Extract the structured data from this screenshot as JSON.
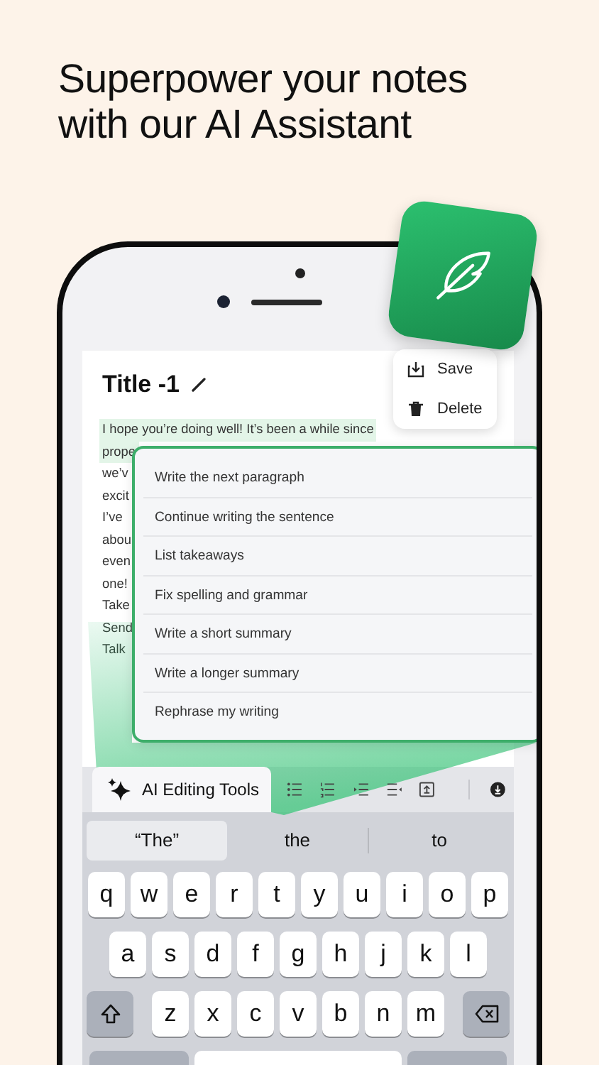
{
  "headline_lines": [
    "Superpower your notes",
    "with our AI Assistant"
  ],
  "note": {
    "title": "Title -1",
    "body_lines": [
      {
        "text": "I hope you’re doing well! It’s been a while since",
        "selected": true
      },
      {
        "text": "prope",
        "selected": true
      },
      {
        "text": "we’v",
        "selected": false
      },
      {
        "text": "excit",
        "selected": false
      },
      {
        "text": "I’ve",
        "selected": false
      },
      {
        "text": "abou",
        "selected": false
      },
      {
        "text": "even",
        "selected": false
      },
      {
        "text": "one!",
        "selected": false
      },
      {
        "text": "Take",
        "selected": false
      },
      {
        "text": "Send",
        "selected": false
      },
      {
        "text": "Talk",
        "selected": false
      }
    ]
  },
  "note_menu": [
    {
      "kind": "save",
      "label": "Save"
    },
    {
      "kind": "delete",
      "label": "Delete"
    }
  ],
  "ai_menu": [
    "Write the next paragraph",
    "Continue writing the sentence",
    "List takeaways",
    "Fix spelling and grammar",
    "Write a short summary",
    "Write a longer summary",
    "Rephrase my writing"
  ],
  "toolbar": {
    "ai_button": "AI Editing Tools",
    "tools": [
      {
        "kind": "bullets"
      },
      {
        "kind": "numbers"
      },
      {
        "kind": "indent"
      },
      {
        "kind": "outdent"
      },
      {
        "kind": "export"
      },
      {
        "kind": "dismiss"
      }
    ]
  },
  "suggestions": [
    {
      "text": "“The”",
      "selected": true
    },
    {
      "text": "the",
      "selected": false
    },
    {
      "text": "to",
      "selected": false
    }
  ],
  "keyboard": [
    [
      {
        "kind": "letter",
        "label": "q"
      },
      {
        "kind": "letter",
        "label": "w"
      },
      {
        "kind": "letter",
        "label": "e"
      },
      {
        "kind": "letter",
        "label": "r"
      },
      {
        "kind": "letter",
        "label": "t"
      },
      {
        "kind": "letter",
        "label": "y"
      },
      {
        "kind": "letter",
        "label": "u"
      },
      {
        "kind": "letter",
        "label": "i"
      },
      {
        "kind": "letter",
        "label": "o"
      },
      {
        "kind": "letter",
        "label": "p"
      }
    ],
    [
      {
        "kind": "letter",
        "label": "a"
      },
      {
        "kind": "letter",
        "label": "s"
      },
      {
        "kind": "letter",
        "label": "d"
      },
      {
        "kind": "letter",
        "label": "f"
      },
      {
        "kind": "letter",
        "label": "g"
      },
      {
        "kind": "letter",
        "label": "h"
      },
      {
        "kind": "letter",
        "label": "j"
      },
      {
        "kind": "letter",
        "label": "k"
      },
      {
        "kind": "letter",
        "label": "l"
      }
    ],
    [
      {
        "kind": "shift"
      },
      {
        "kind": "letter",
        "label": "z"
      },
      {
        "kind": "letter",
        "label": "x"
      },
      {
        "kind": "letter",
        "label": "c"
      },
      {
        "kind": "letter",
        "label": "v"
      },
      {
        "kind": "letter",
        "label": "b"
      },
      {
        "kind": "letter",
        "label": "n"
      },
      {
        "kind": "letter",
        "label": "m"
      },
      {
        "kind": "backspace"
      }
    ],
    [
      {
        "kind": "mode"
      },
      {
        "kind": "space"
      },
      {
        "kind": "return"
      }
    ]
  ]
}
